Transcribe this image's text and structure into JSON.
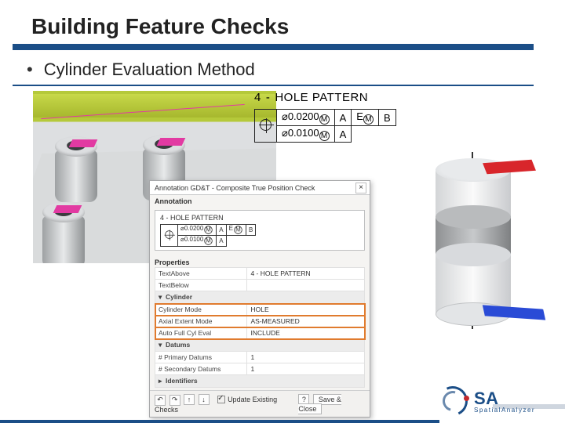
{
  "slide": {
    "title": "Building Feature Checks",
    "bullet": "Cylinder Evaluation Method"
  },
  "callout": {
    "prefix": "4",
    "sep": "-",
    "name": "HOLE PATTERN",
    "row1": {
      "tol": "⌀0.0200",
      "mod": "M",
      "d1": "A",
      "d2": "E",
      "d2mod": "M",
      "d3": "B"
    },
    "row2": {
      "tol": "⌀0.0100",
      "mod": "M",
      "d1": "A"
    }
  },
  "dialog": {
    "title": "Annotation GD&T - Composite True Position Check",
    "section_annotation": "Annotation",
    "anno_label": "4 - HOLE PATTERN",
    "fcf": {
      "r1": {
        "tol": "⌀0.0200",
        "mod": "M",
        "d1": "A",
        "d2": "E",
        "d2mod": "M",
        "d3": "B"
      },
      "r2": {
        "tol": "⌀0.0100",
        "mod": "M",
        "d1": "A"
      }
    },
    "section_properties": "Properties",
    "rows": {
      "text_above_k": "TextAbove",
      "text_above_v": "4 - HOLE PATTERN",
      "text_below_k": "TextBelow",
      "text_below_v": "",
      "grp_cyl": "Cylinder",
      "cyl_mode_k": "Cylinder Mode",
      "cyl_mode_v": "HOLE",
      "axial_k": "Axial Extent Mode",
      "axial_v": "AS-MEASURED",
      "auto_k": "Auto Full Cyl Eval",
      "auto_v": "INCLUDE",
      "grp_datums": "Datums",
      "prim_k": "# Primary Datums",
      "prim_v": "1",
      "sec_k": "# Secondary Datums",
      "sec_v": "1",
      "grp_ident": "Identifiers"
    },
    "footer": {
      "update": "Update Existing Checks",
      "save": "Save & Close"
    }
  },
  "brand": {
    "main": "SA",
    "sub": "SpatialAnalyzer"
  }
}
